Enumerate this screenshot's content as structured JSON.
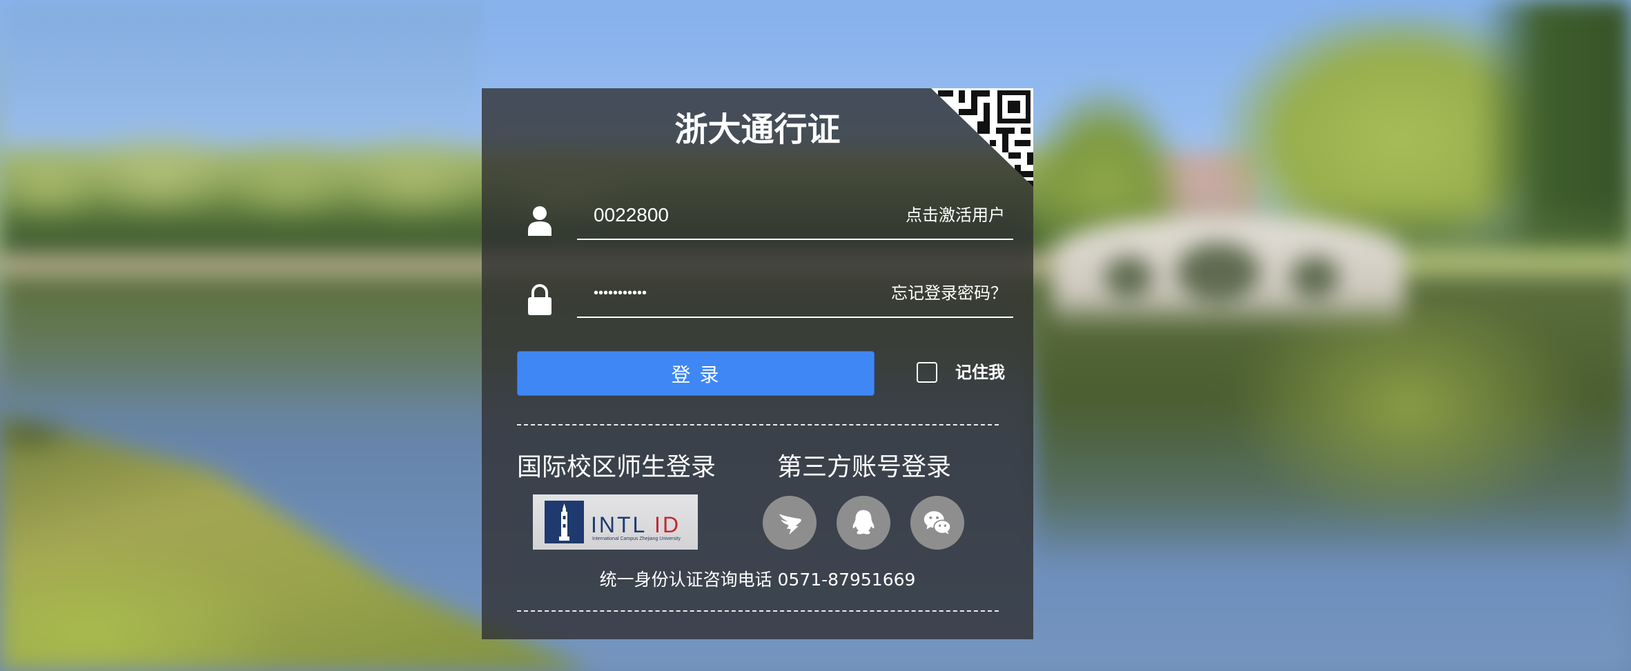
{
  "page": {
    "title": "浙大通行证"
  },
  "login": {
    "username": {
      "value": "0022800",
      "link_label": "点击激活用户"
    },
    "password": {
      "value": "•••••••••••",
      "link_label": "忘记登录密码？"
    },
    "submit_label": "登 录",
    "remember_me": {
      "label": "记住我",
      "checked": false
    }
  },
  "intl_campus": {
    "heading": "国际校区师生登录",
    "logo": {
      "word_a": "INTL",
      "word_b": "ID",
      "tagline": "International Campus Zhejiang University"
    }
  },
  "third_party": {
    "heading": "第三方账号登录",
    "providers": [
      {
        "icon": "dingtalk-icon"
      },
      {
        "icon": "qq-icon"
      },
      {
        "icon": "wechat-icon"
      }
    ]
  },
  "footer": {
    "hotline": "统一身份认证咨询电话 0571-87951669"
  },
  "icons": {
    "username": "user-icon",
    "password": "lock-icon",
    "qr_login": "qr-code-icon"
  },
  "colors": {
    "accent": "#3f87f5",
    "panel": "#2e2e30",
    "text": "#ffffff",
    "intl_navy": "#1f3a6e",
    "intl_red": "#c2272d",
    "provider_circle": "#8e8e8e"
  }
}
